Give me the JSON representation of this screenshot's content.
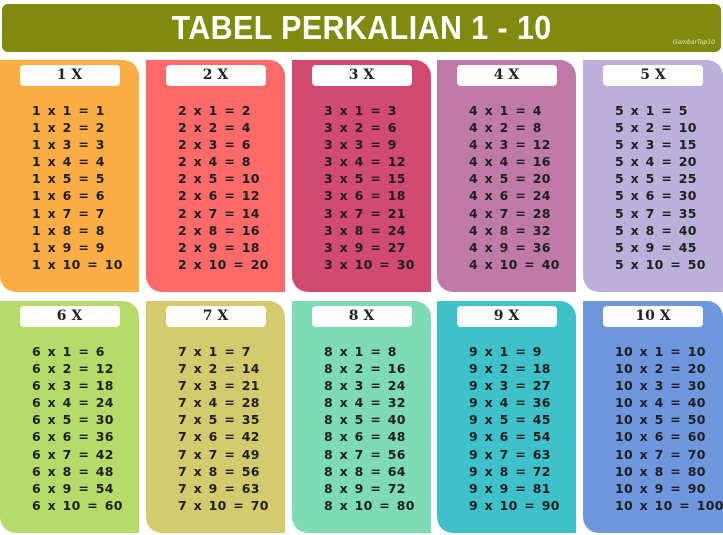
{
  "title": "TABEL PERKALIAN 1 - 10",
  "watermark": "GambarTop10",
  "cards": [
    {
      "label": "1 X",
      "color": "#fbae45",
      "rows": [
        "1 x 1 = 1",
        "1 x 2 = 2",
        "1 x 3 = 3",
        "1 x 4 = 4",
        "1 x 5 = 5",
        "1 x 6 = 6",
        "1 x 7 = 7",
        "1 x 8 = 8",
        "1 x 9 = 9",
        "1 x 10 = 10"
      ]
    },
    {
      "label": "2 X",
      "color": "#fc6a69",
      "rows": [
        "2 x 1 = 2",
        "2 x 2 = 4",
        "2 x 3 = 6",
        "2 x 4 = 8",
        "2 x 5 = 10",
        "2 x 6 = 12",
        "2 x 7 = 14",
        "2 x 8 = 16",
        "2 x 9 = 18",
        "2 x 10 = 20"
      ]
    },
    {
      "label": "3 X",
      "color": "#d04a72",
      "rows": [
        "3 x 1 = 3",
        "3 x 2 = 6",
        "3 x 3 = 9",
        "3 x 4 = 12",
        "3 x 5 = 15",
        "3 x 6 = 18",
        "3 x 7 = 21",
        "3 x 8 = 24",
        "3 x 9 = 27",
        "3 x 10 = 30"
      ]
    },
    {
      "label": "4 X",
      "color": "#c07aa8",
      "rows": [
        "4 x 1 = 4",
        "4 x 2 = 8",
        "4 x 3 = 12",
        "4 x 4 = 16",
        "4 x 5 = 20",
        "4 x 6 = 24",
        "4 x 7 = 28",
        "4 x 8 = 32",
        "4 x 9 = 36",
        "4 x 10 = 40"
      ]
    },
    {
      "label": "5 X",
      "color": "#bdb1db",
      "rows": [
        "5 x 1 = 5",
        "5 x 2 = 10",
        "5 x 3 = 15",
        "5 x 4 = 20",
        "5 x 5 = 25",
        "5 x 6 = 30",
        "5 x 7 = 35",
        "5 x 8 = 40",
        "5 x 9 = 45",
        "5 x 10 = 50"
      ]
    },
    {
      "label": "6 X",
      "color": "#b6db6a",
      "rows": [
        "6 x 1 = 6",
        "6 x 2 = 12",
        "6 x 3 = 18",
        "6 x 4 = 24",
        "6 x 5 = 30",
        "6 x 6 = 36",
        "6 x 7 = 42",
        "6 x 8 = 48",
        "6 x 9 = 54",
        "6 x 10 = 60"
      ]
    },
    {
      "label": "7 X",
      "color": "#d4cb6f",
      "rows": [
        "7 x 1 = 7",
        "7 x 2 = 14",
        "7 x 3 = 21",
        "7 x 4 = 28",
        "7 x 5 = 35",
        "7 x 6 = 42",
        "7 x 7 = 49",
        "7 x 8 = 56",
        "7 x 9 = 63",
        "7 x 10 = 70"
      ]
    },
    {
      "label": "8 X",
      "color": "#7edbb5",
      "rows": [
        "8 x 1 = 8",
        "8 x 2 = 16",
        "8 x 3 = 24",
        "8 x 4 = 32",
        "8 x 5 = 40",
        "8 x 6 = 48",
        "8 x 7 = 56",
        "8 x 8 = 64",
        "8 x 9 = 72",
        "8 x 10 = 80"
      ]
    },
    {
      "label": "9 X",
      "color": "#3fc1c9",
      "rows": [
        "9 x 1 = 9",
        "9 x 2 = 18",
        "9 x 3 = 27",
        "9 x 4 = 36",
        "9 x 5 = 45",
        "9 x 6 = 54",
        "9 x 7 = 63",
        "9 x 8 = 72",
        "9 x 9 = 81",
        "9 x 10 = 90"
      ]
    },
    {
      "label": "10 X",
      "color": "#6f97dd",
      "rows": [
        "10 x 1 = 10",
        "10 x 2 = 20",
        "10 x 3 = 30",
        "10 x 4 = 40",
        "10 x 5 = 50",
        "10 x 6 = 60",
        "10 x 7 = 70",
        "10 x 8 = 80",
        "10 x 9 = 90",
        "10 x 10 = 100"
      ]
    }
  ]
}
